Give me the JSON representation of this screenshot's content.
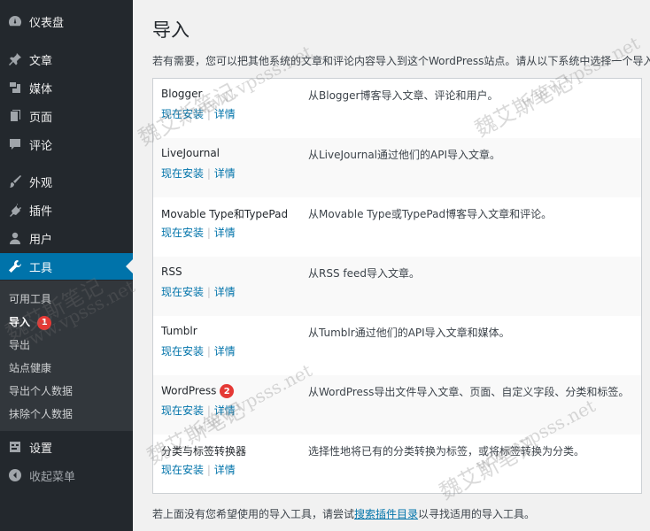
{
  "sidebar": {
    "menu": [
      {
        "label": "仪表盘",
        "icon": "dashboard-icon"
      },
      {
        "label": "文章",
        "icon": "pin-icon"
      },
      {
        "label": "媒体",
        "icon": "media-icon"
      },
      {
        "label": "页面",
        "icon": "page-icon"
      },
      {
        "label": "评论",
        "icon": "comment-icon"
      },
      {
        "label": "外观",
        "icon": "brush-icon"
      },
      {
        "label": "插件",
        "icon": "plugin-icon"
      },
      {
        "label": "用户",
        "icon": "user-icon"
      },
      {
        "label": "工具",
        "icon": "wrench-icon"
      },
      {
        "label": "设置",
        "icon": "settings-icon"
      },
      {
        "label": "收起菜单",
        "icon": "collapse-icon"
      }
    ],
    "tools_submenu": [
      {
        "label": "可用工具"
      },
      {
        "label": "导入",
        "badge": "1"
      },
      {
        "label": "导出"
      },
      {
        "label": "站点健康"
      },
      {
        "label": "导出个人数据"
      },
      {
        "label": "抹除个人数据"
      }
    ]
  },
  "page": {
    "title": "导入",
    "intro": "若有需要，您可以把其他系统的文章和评论内容导入到这个WordPress站点。请从以下系统中选择一个导入",
    "action_install": "现在安装",
    "action_sep": "|",
    "action_details": "详情",
    "importers": [
      {
        "name": "Blogger",
        "desc": "从Blogger博客导入文章、评论和用户。"
      },
      {
        "name": "LiveJournal",
        "desc": "从LiveJournal通过他们的API导入文章。"
      },
      {
        "name": "Movable Type和TypePad",
        "desc": "从Movable Type或TypePad博客导入文章和评论。"
      },
      {
        "name": "RSS",
        "desc": "从RSS feed导入文章。"
      },
      {
        "name": "Tumblr",
        "desc": "从Tumblr通过他们的API导入文章和媒体。"
      },
      {
        "name": "WordPress",
        "desc": "从WordPress导出文件导入文章、页面、自定义字段、分类和标签。",
        "badge": "2"
      },
      {
        "name": "分类与标签转换器",
        "desc": "选择性地将已有的分类转换为标签，或将标签转换为分类。"
      }
    ],
    "footer_before": "若上面没有您希望使用的导入工具，请尝试",
    "footer_link": "搜索插件目录",
    "footer_after": "以寻找适用的导入工具。"
  },
  "watermark": {
    "cn": "魏艾斯笔记",
    "url": "www.vpsss.net"
  },
  "colors": {
    "sidebar_bg": "#23282d",
    "active_bg": "#0073aa",
    "link": "#0073aa",
    "badge": "#e53935"
  }
}
